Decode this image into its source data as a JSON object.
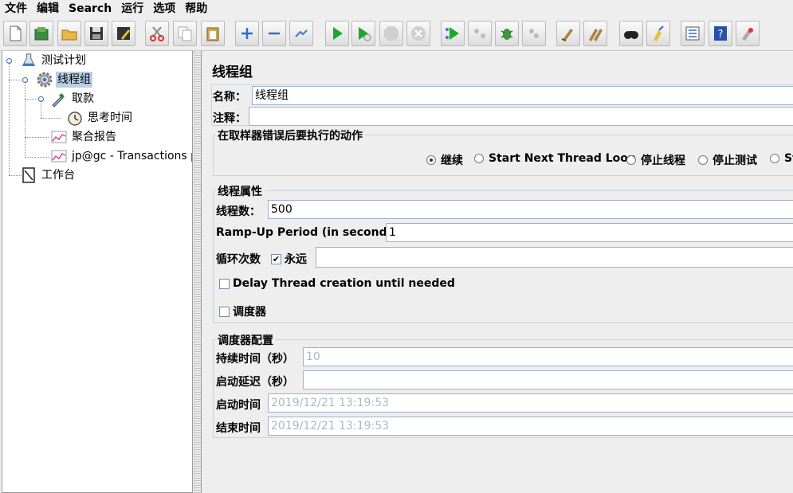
{
  "menu": [
    "文件",
    "编辑",
    "Search",
    "运行",
    "选项",
    "帮助"
  ],
  "toolbar_icons": [
    "new-icon",
    "templates-icon",
    "open-icon",
    "save-icon",
    "save-as-icon",
    "cut-icon",
    "copy-icon",
    "paste-icon",
    "expand-icon",
    "collapse-icon",
    "toggle-icon",
    "start-icon",
    "start-no-pauses-icon",
    "stop-icon",
    "shutdown-icon",
    "remote-start-icon",
    "remote-stop-icon",
    "remote-shutdown-icon",
    "remote-exit-icon",
    "clear-icon",
    "clear-all-icon",
    "search-icon",
    "reset-search-icon",
    "function-helper-icon",
    "help-icon",
    "log-viewer-icon"
  ],
  "tree": {
    "test_plan": "测试计划",
    "thread_group": "线程组",
    "sampler": "取款",
    "timer": "思考时间",
    "aggregate_report": "聚合报告",
    "transactions_listener": "jp@gc - Transactions pe",
    "workbench": "工作台"
  },
  "panel": {
    "title": "线程组",
    "name_label": "名称：",
    "name_value": "线程组",
    "comment_label": "注释：",
    "comment_value": "",
    "error_action": {
      "title": "在取样器错误后要执行的动作",
      "options": [
        "继续",
        "Start Next Thread Loop",
        "停止线程",
        "停止测试",
        "St"
      ],
      "selected": "继续"
    },
    "thread_props": {
      "title": "线程属性",
      "threads_label": "线程数：",
      "threads_value": "500",
      "rampup_label": "Ramp-Up Period (in seconds):",
      "rampup_value": "1",
      "loop_label": "循环次数",
      "forever_label": "永远",
      "forever_checked": true,
      "loop_value": "",
      "delay_label": "Delay Thread creation until needed",
      "delay_checked": false,
      "scheduler_label": "调度器",
      "scheduler_checked": false
    },
    "scheduler_config": {
      "title": "调度器配置",
      "duration_label": "持续时间（秒）",
      "duration_value": "10",
      "delay_label": "启动延迟（秒）",
      "delay_value": "",
      "start_label": "启动时间",
      "start_value": "2019/12/21 13:19:53",
      "end_label": "结束时间",
      "end_value": "2019/12/21 13:19:53"
    }
  }
}
